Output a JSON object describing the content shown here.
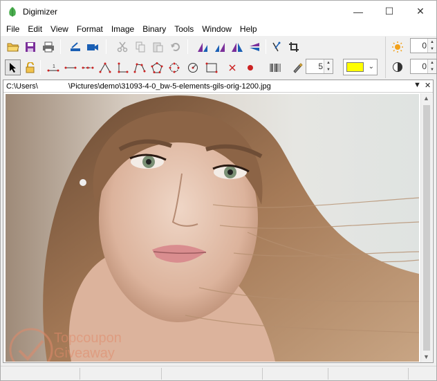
{
  "window": {
    "title": "Digimizer",
    "minimize": "—",
    "maximize": "☐",
    "close": "✕"
  },
  "menu": [
    {
      "label": "File"
    },
    {
      "label": "Edit"
    },
    {
      "label": "View"
    },
    {
      "label": "Format"
    },
    {
      "label": "Image"
    },
    {
      "label": "Binary"
    },
    {
      "label": "Tools"
    },
    {
      "label": "Window"
    },
    {
      "label": "Help"
    }
  ],
  "toolbar2": {
    "line_width": "5",
    "color_hex": "#ffff00"
  },
  "adjust": {
    "brightness": "0",
    "contrast": "0"
  },
  "document": {
    "path": "C:\\Users\\    \\Pictures\\demo\\31093-4-0_bw-5-elements-gils-orig-1200.jpg",
    "menu_arrow": "▼",
    "close": "✕"
  },
  "watermark": {
    "line1": "Topcoupon",
    "line2": "Giveaway"
  },
  "colors": {
    "accent_blue": "#1a5fb4",
    "marker_red": "#cc2222",
    "swatch": "#ffff00"
  }
}
